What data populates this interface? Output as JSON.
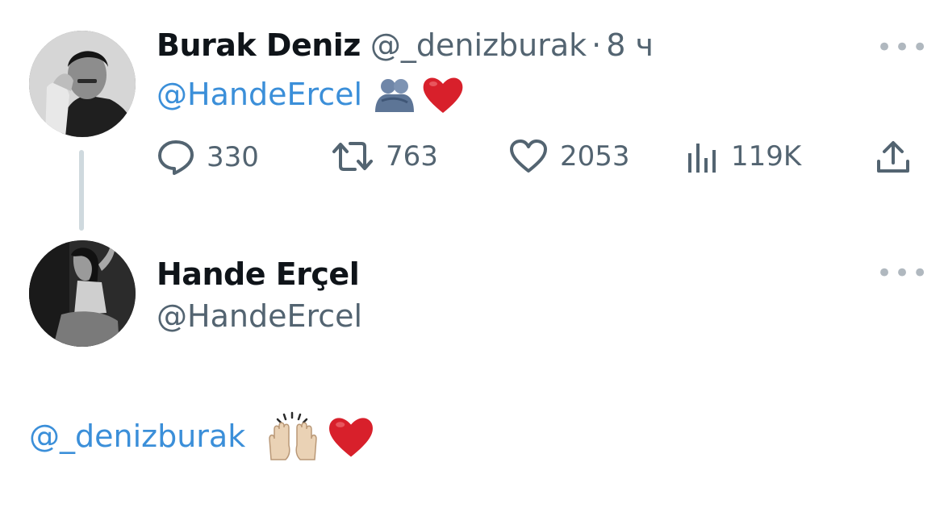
{
  "tweet": {
    "author_name": "Burak Deniz",
    "author_handle": "@_denizburak",
    "separator": "·",
    "time": "8 ч",
    "text_mention": "@HandeErcel",
    "emoji_hug": "🫂",
    "emoji_heart": "❤️",
    "actions": {
      "replies": "330",
      "retweets": "763",
      "likes": "2053",
      "views": "119K"
    },
    "more_label": "•••"
  },
  "reply": {
    "author_name": "Hande Erçel",
    "author_handle": "@HandeErcel",
    "more_label": "•••",
    "text_mention": "@_denizburak",
    "emoji_hands": "🙌🏼",
    "emoji_heart": "❤️"
  },
  "colors": {
    "link": "#3b8fd9",
    "secondary_text": "#536471",
    "heart": "#d8202b",
    "thread_line": "#cfd9de"
  },
  "icons": [
    "reply-icon",
    "retweet-icon",
    "like-icon",
    "views-icon",
    "share-icon",
    "more-icon"
  ]
}
